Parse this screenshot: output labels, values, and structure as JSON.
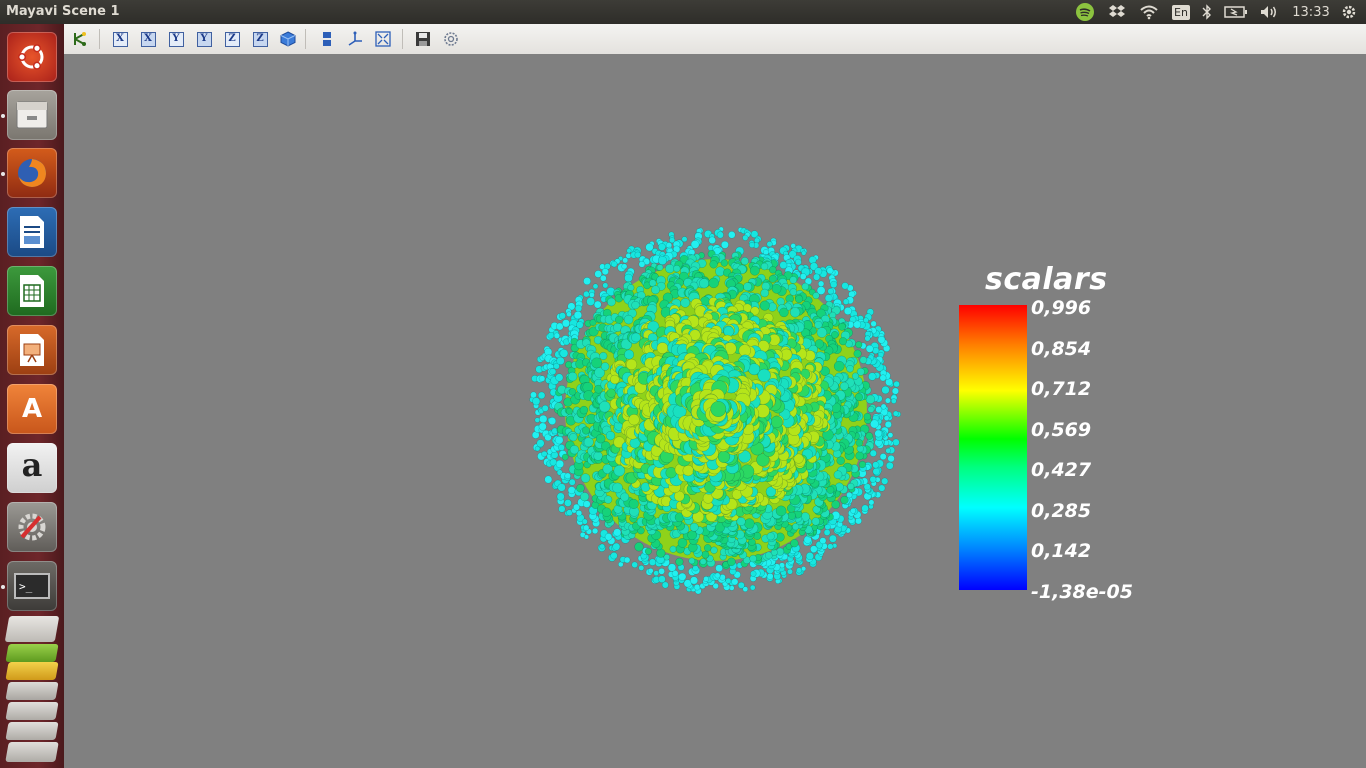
{
  "window": {
    "title": "Mayavi Scene 1"
  },
  "panel": {
    "language": "En",
    "clock": "13:33",
    "indicators": [
      "spotify-icon",
      "dropbox-icon",
      "wifi-icon",
      "keyboard-language-icon",
      "bluetooth-icon",
      "battery-icon",
      "volume-icon",
      "session-gear-icon"
    ]
  },
  "launcher": {
    "items": [
      {
        "name": "ubuntu-dash-icon"
      },
      {
        "name": "files-icon"
      },
      {
        "name": "firefox-icon"
      },
      {
        "name": "libreoffice-writer-icon"
      },
      {
        "name": "libreoffice-calc-icon"
      },
      {
        "name": "libreoffice-impress-icon"
      },
      {
        "name": "software-center-icon",
        "glyph": "A"
      },
      {
        "name": "amazon-icon",
        "glyph": "a"
      },
      {
        "name": "system-settings-icon"
      },
      {
        "name": "terminal-icon",
        "glyph": ">_"
      }
    ]
  },
  "toolbar": {
    "axis_buttons": [
      "X",
      "X",
      "Y",
      "Y",
      "Z",
      "Z"
    ],
    "tools": [
      "pipeline-icon",
      "iso-view-icon",
      "parallel-projection-icon",
      "show-axes-icon",
      "full-screen-icon",
      "save-icon",
      "configure-icon"
    ]
  },
  "colorbar": {
    "title": "scalars",
    "ticks": [
      "0,996",
      "0,854",
      "0,712",
      "0,569",
      "0,427",
      "0,285",
      "0,142",
      "-1,38e-05"
    ],
    "colors": [
      "#ff0000",
      "#ff7f00",
      "#ffff00",
      "#00ff00",
      "#00ff80",
      "#00ffff",
      "#0080ff",
      "#0000ff"
    ]
  },
  "scene": {
    "background": "#808080",
    "object": "sphere-of-glyphs"
  }
}
